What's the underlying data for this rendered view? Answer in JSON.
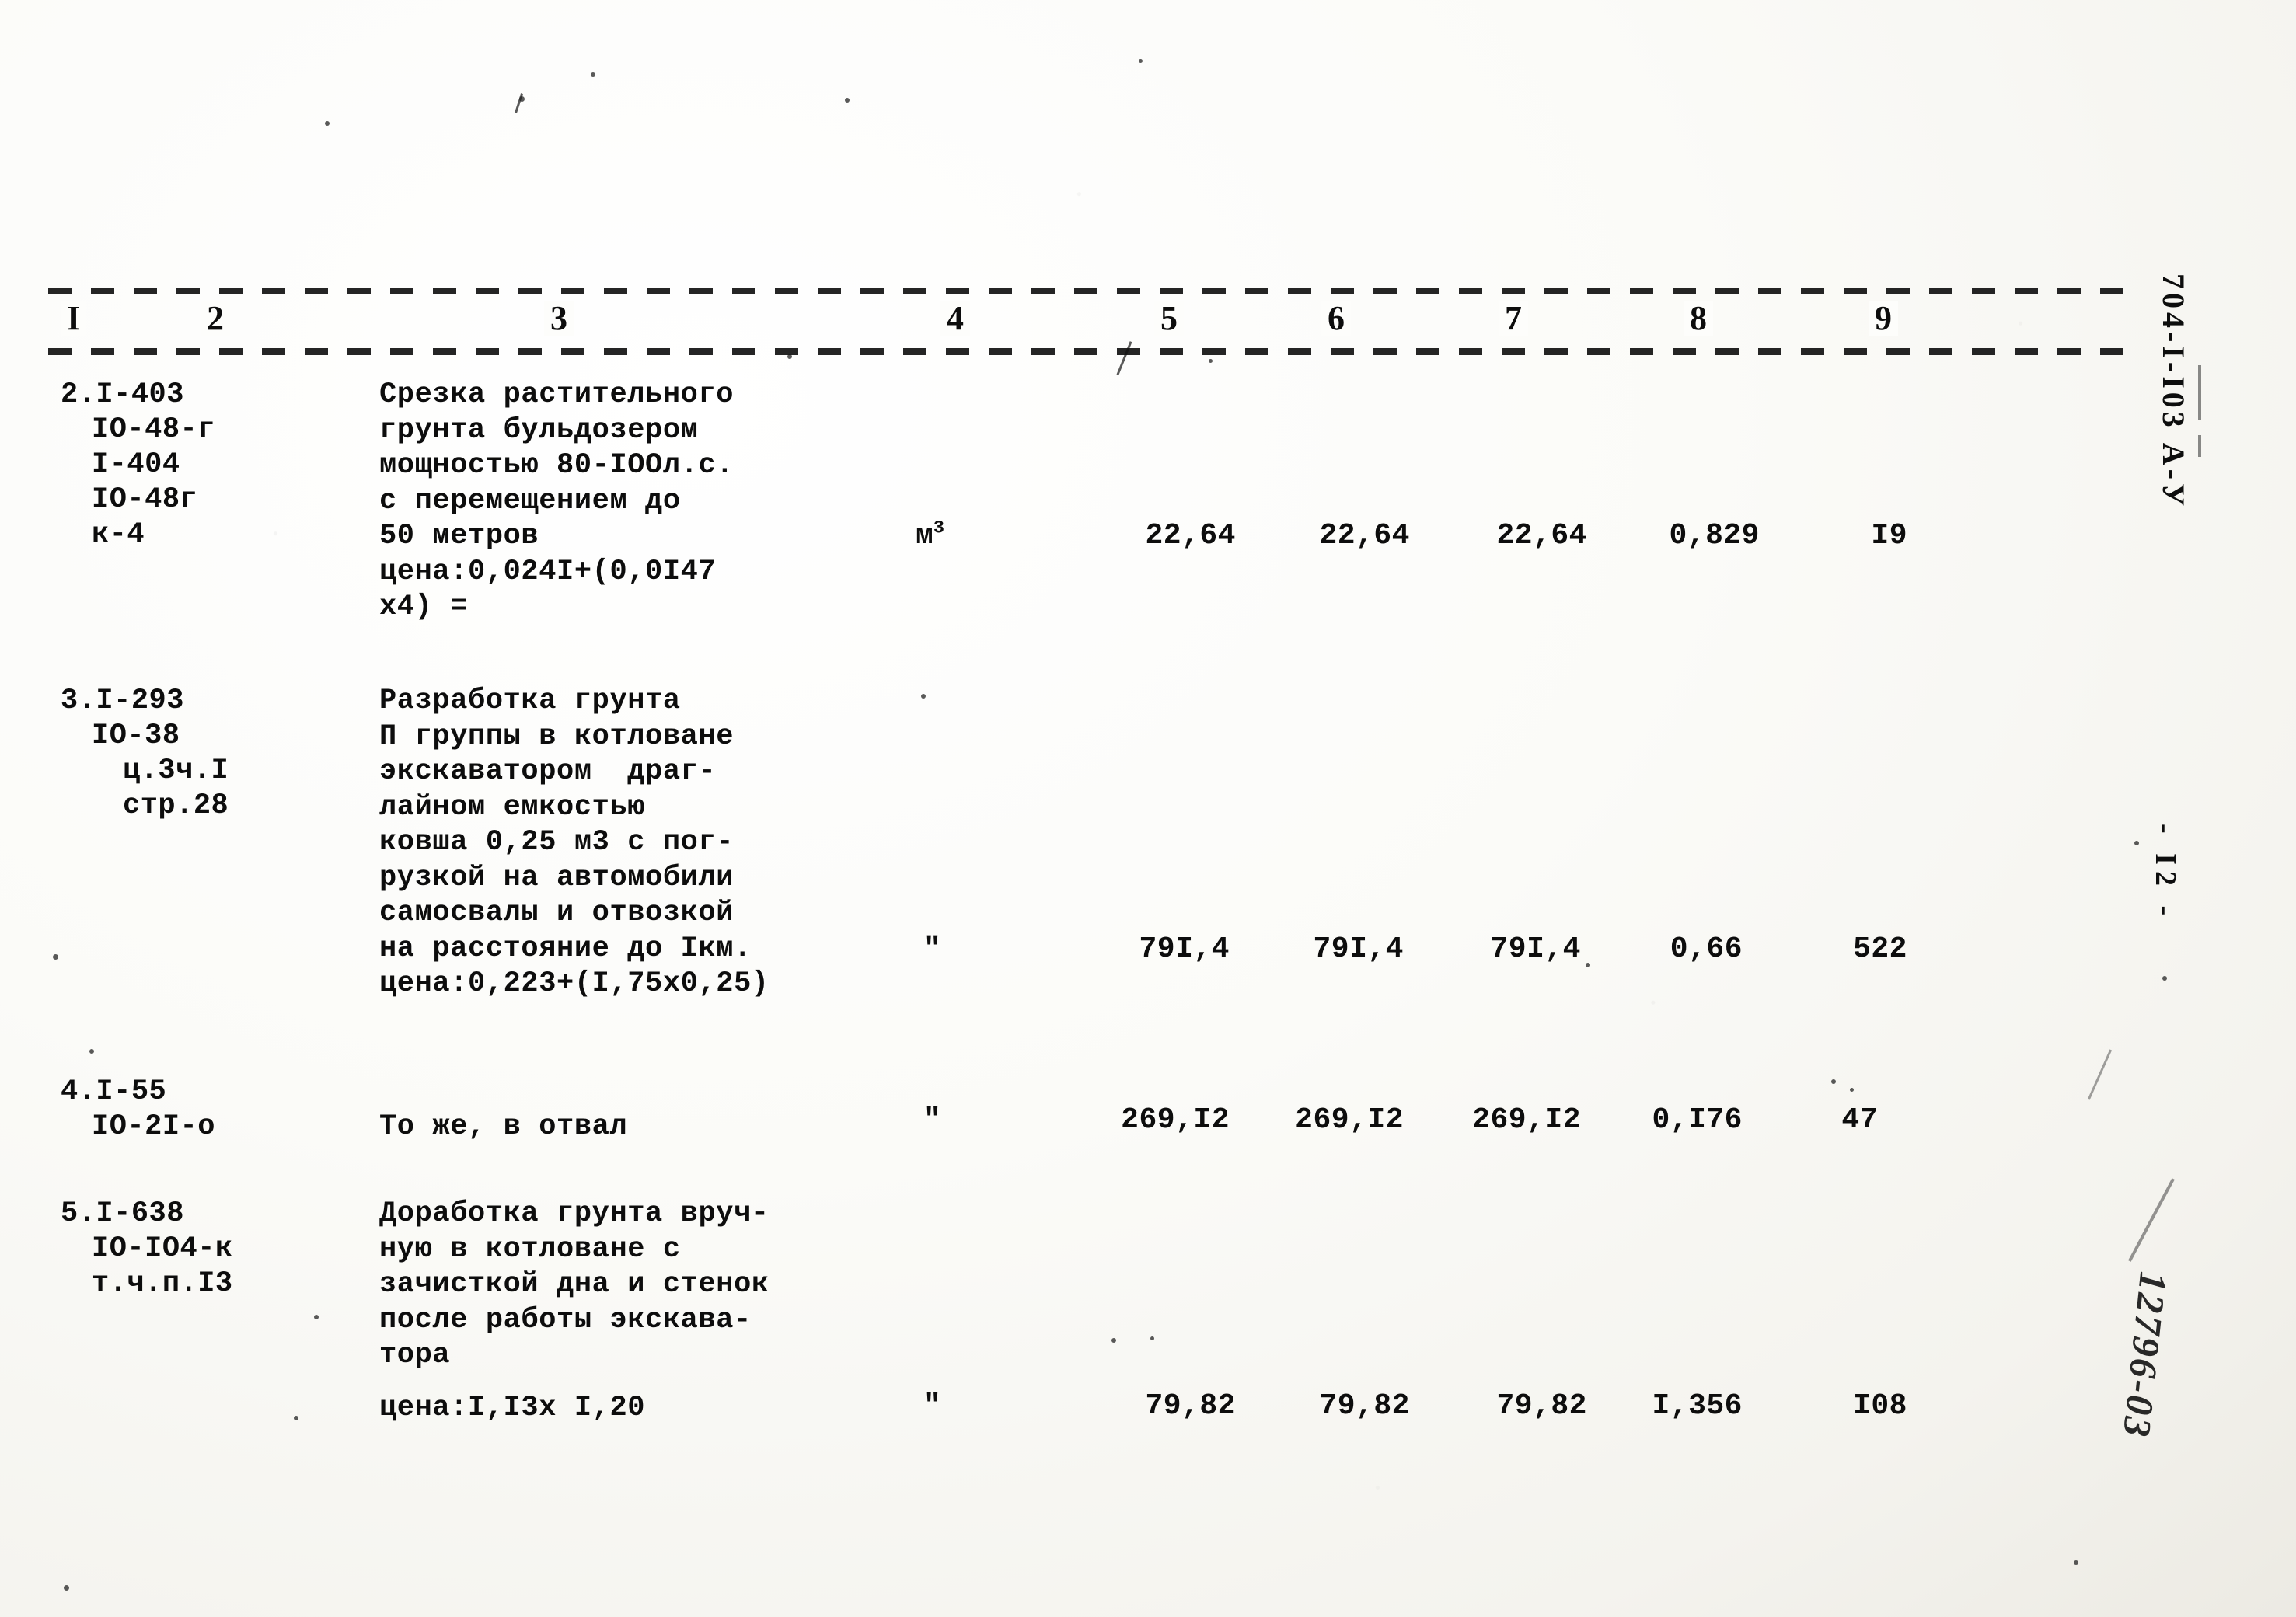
{
  "document": {
    "margin_code": "704-I-I03  А-У",
    "page_number": "- I2 -",
    "handwritten_number": "12796-03"
  },
  "table": {
    "column_headers": [
      "I",
      "2",
      "3",
      "4",
      "5",
      "6",
      "7",
      "8",
      "9"
    ],
    "rows": [
      {
        "item_no": "2.I-403",
        "codes": [
          "2.I-403",
          "IO-48-г",
          "I-404",
          "IO-48г",
          "к-4"
        ],
        "description": "Срезка растительного\nгрунта бульдозером\nмощностью 80-IOOл.с.\nс перемещением до\n50 метров\nцена:0,024I+(0,0I47\nх4) =",
        "unit": "м3",
        "col5": "22,64",
        "col6": "22,64",
        "col7": "22,64",
        "col8": "0,829",
        "col9": "I9"
      },
      {
        "item_no": "3.I-293",
        "codes": [
          "3.I-293",
          "IO-38",
          "ц.3ч.I",
          "стр.28"
        ],
        "description": "Разработка грунта\nП группы в котловане\nэкскаватором  драг-\nлайном емкостью\nковша 0,25 м3 с пог-\nрузкой на автомобили\nсамосвалы и отвозкой\nна расстояние до Iкм.\nцена:0,223+(I,75х0,25)",
        "unit": "\"",
        "col5": "79I,4",
        "col6": "79I,4",
        "col7": "79I,4",
        "col8": "0,66",
        "col9": "522"
      },
      {
        "item_no": "4.I-55",
        "codes": [
          "4.I-55",
          "IO-2I-о"
        ],
        "description": "То же, в отвал",
        "unit": "\"",
        "col5": "269,I2",
        "col6": "269,I2",
        "col7": "269,I2",
        "col8": "0,I76",
        "col9": "47"
      },
      {
        "item_no": "5.I-638",
        "codes": [
          "5.I-638",
          "IO-IO4-к",
          "т.ч.п.I3"
        ],
        "description": "Доработка грунта вруч-\nную в котловане с\nзачисткой дна и стенок\nпосле работы экскава-\nтора",
        "description2": "цена:I,I3х I,20",
        "unit": "\"",
        "col5": "79,82",
        "col6": "79,82",
        "col7": "79,82",
        "col8": "I,356",
        "col9": "I08"
      }
    ]
  }
}
